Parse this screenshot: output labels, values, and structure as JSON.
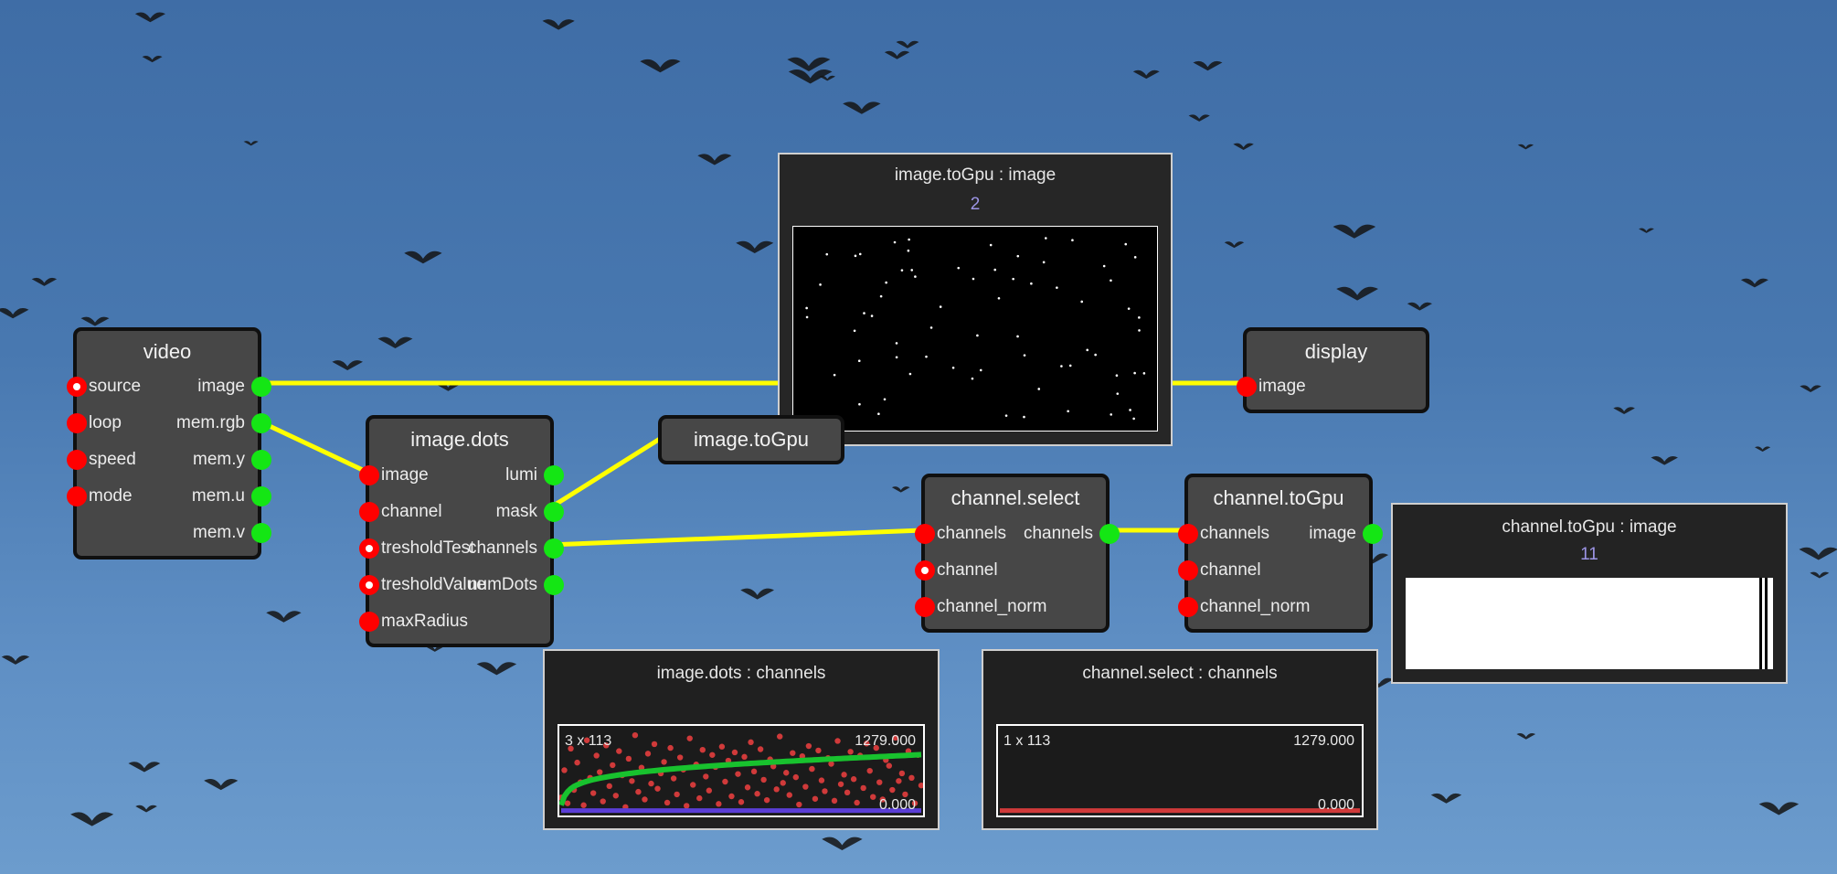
{
  "nodes": {
    "video": {
      "title": "video",
      "inputs": [
        "source",
        "loop",
        "speed",
        "mode"
      ],
      "outputs": [
        "image",
        "mem.rgb",
        "mem.y",
        "mem.u",
        "mem.v"
      ]
    },
    "image_dots": {
      "title": "image.dots",
      "inputs": [
        "image",
        "channel",
        "tresholdTest",
        "tresholdValue",
        "maxRadius"
      ],
      "outputs": [
        "lumi",
        "mask",
        "channels",
        "numDots"
      ]
    },
    "image_togpu": {
      "title": "image.toGpu"
    },
    "display": {
      "title": "display",
      "inputs": [
        "image"
      ]
    },
    "channel_select": {
      "title": "channel.select",
      "inputs": [
        "channels",
        "channel",
        "channel_norm"
      ],
      "outputs": [
        "channels"
      ]
    },
    "channel_togpu": {
      "title": "channel.toGpu",
      "inputs": [
        "channels",
        "channel",
        "channel_norm"
      ],
      "outputs": [
        "image"
      ]
    }
  },
  "previews": {
    "image_togpu": {
      "title": "image.toGpu : image",
      "count": "2"
    },
    "channel_togpu": {
      "title": "channel.toGpu : image",
      "count": "11"
    },
    "image_dots": {
      "title": "image.dots : channels",
      "dims": "3 x 113",
      "max": "1279.000",
      "min": "0.000"
    },
    "channel_select": {
      "title": "channel.select : channels",
      "dims": "1 x 113",
      "max": "1279.000",
      "min": "0.000"
    }
  },
  "colors": {
    "wire": "#ffff00",
    "port_in": "#ff0000",
    "port_out": "#14e614",
    "node_bg": "#474747",
    "scatter": "#d03a3a",
    "curve": "#18c22e",
    "baseline": "#5a3ed6"
  },
  "chart_data": [
    {
      "type": "scatter",
      "title": "image.dots : channels",
      "dims": "3 x 113",
      "ylim": [
        0,
        1279.0
      ],
      "series": [
        {
          "values": [
            210,
            640,
            120,
            980,
            330,
            760,
            450,
            90,
            1110,
            520,
            280,
            870,
            610,
            150,
            1030,
            390,
            720,
            240,
            940,
            560,
            60,
            820,
            470,
            1190,
            300,
            680,
            180,
            900,
            430,
            1050,
            350,
            590,
            770,
            130,
            990,
            510,
            260,
            840,
            650,
            80,
            1140,
            410,
            730,
            200,
            960,
            540,
            320,
            880,
            690,
            110,
            1010,
            460,
            790,
            230,
            920,
            580,
            140,
            850,
            370,
            1080,
            620,
            270,
            970,
            490,
            170,
            810,
            700,
            340,
            1170,
            440,
            600,
            250,
            910,
            530,
            100,
            860,
            380,
            1020,
            660,
            190,
            950,
            480,
            310,
            830,
            740,
            160,
            1100,
            420,
            570,
            290,
            930,
            500,
            130,
            870,
            360,
            1060,
            630,
            220,
            990,
            450,
            180,
            800,
            710,
            330,
            1150,
            470,
            590,
            260,
            940,
            520,
            120,
            880,
            400
          ]
        },
        {
          "values": [
            90,
            230,
            300,
            350,
            385,
            410,
            430,
            450,
            465,
            480,
            492,
            503,
            514,
            524,
            533,
            542,
            550,
            558,
            566,
            573,
            580,
            587,
            593,
            600,
            606,
            612,
            617,
            623,
            628,
            633,
            638,
            643,
            648,
            652,
            657,
            661,
            666,
            670,
            674,
            678,
            682,
            686,
            690,
            694,
            697,
            701,
            705,
            708,
            712,
            715,
            719,
            722,
            725,
            728,
            732,
            735,
            738,
            741,
            744,
            747,
            750,
            753,
            756,
            759,
            762,
            765,
            768,
            770,
            773,
            776,
            779,
            782,
            784,
            787,
            790,
            792,
            795,
            798,
            800,
            803,
            805,
            808,
            811,
            813,
            816,
            818,
            821,
            823,
            826,
            828,
            831,
            833,
            836,
            838,
            840,
            843,
            845,
            848,
            850,
            853,
            855,
            857,
            860,
            862,
            865,
            867,
            870,
            872,
            874,
            877,
            880,
            882,
            885
          ]
        },
        {
          "values": [
            5,
            5,
            5,
            5,
            5
          ]
        }
      ]
    },
    {
      "type": "line",
      "title": "channel.select : channels",
      "dims": "1 x 113",
      "ylim": [
        0,
        1279.0
      ],
      "series": [
        {
          "values": [
            5,
            5,
            5,
            5,
            5
          ]
        }
      ]
    }
  ]
}
